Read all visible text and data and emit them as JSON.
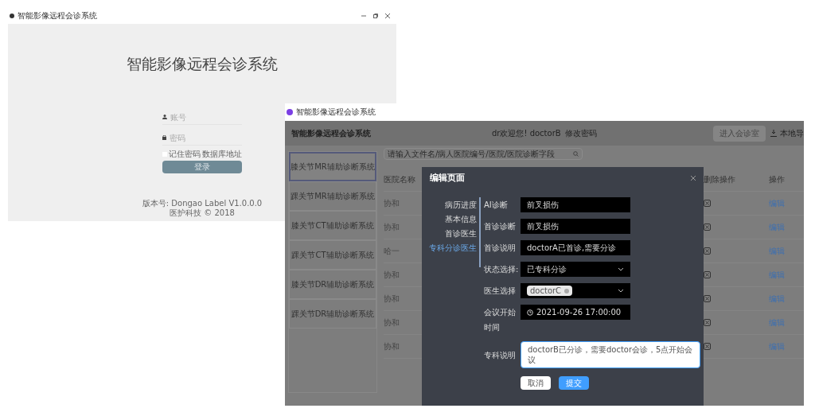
{
  "login_window": {
    "title": "智能影像远程会诊系统",
    "heading": "智能影像远程会诊系统",
    "username_placeholder": "账号",
    "password_placeholder": "密码",
    "remember": {
      "label": "记住密码",
      "checked": false
    },
    "link": "数据库地址",
    "login_button": "登录",
    "footer_lines": [
      "版本号: Dongao Label V1.0.0.0",
      "医护科技 © 2018"
    ]
  },
  "main_window": {
    "title": "智能影像远程会诊系统",
    "app_title": "智能影像远程会诊系统",
    "welcome": "dr欢迎您! doctorB",
    "change_password": "修改密码",
    "enter_button": "进入会诊室",
    "import_button": "本地导",
    "search_placeholder": "请输入文件名/病人医院编号/医院/医院诊断字段",
    "sidebar": [
      {
        "label": "膝关节MR辅助诊断系统",
        "selected": true
      },
      {
        "label": "踝关节MR辅助诊断系统",
        "selected": false
      },
      {
        "label": "膝关节CT辅助诊断系统",
        "selected": false
      },
      {
        "label": "踝关节CT辅助诊断系统",
        "selected": false
      },
      {
        "label": "膝关节DR辅助诊断系统",
        "selected": false
      },
      {
        "label": "踝关节DR辅助诊断系统",
        "selected": false
      }
    ],
    "table": {
      "columns": [
        "医院名称",
        "删除操作",
        "操作"
      ],
      "rows": [
        {
          "hospital": "协和",
          "action": "编辑"
        },
        {
          "hospital": "协和",
          "action": "编辑"
        },
        {
          "hospital": "哈一",
          "action": "编辑"
        },
        {
          "hospital": "协和",
          "action": "编辑"
        },
        {
          "hospital": "协和",
          "action": "编辑"
        },
        {
          "hospital": "协和",
          "action": "编辑"
        },
        {
          "hospital": "协和",
          "action": "编辑"
        }
      ]
    },
    "modal": {
      "title": "编辑页面",
      "steps": [
        {
          "label": "病历进度",
          "selected": false
        },
        {
          "label": "基本信息",
          "selected": false
        },
        {
          "label": "首诊医生",
          "selected": false
        },
        {
          "label": "专科分诊医生",
          "selected": true
        }
      ],
      "fields": [
        {
          "kind": "text",
          "label": "AI诊断",
          "value": "前叉损伤"
        },
        {
          "kind": "text",
          "label": "首诊诊断",
          "value": "前叉损伤"
        },
        {
          "kind": "text",
          "label": "首诊说明",
          "value": "doctorA已首诊,需要分诊"
        },
        {
          "kind": "select",
          "label": "状态选择:",
          "value": "已专科分诊"
        },
        {
          "kind": "tags",
          "label": "医生选择",
          "value": "doctorC"
        },
        {
          "kind": "datetime",
          "label": "会议开始时间",
          "value": "2021-09-26 17:00:00"
        },
        {
          "kind": "textarea",
          "label": "专科说明",
          "value": "doctorB已分诊，需要doctor会诊，5点开始会议"
        }
      ],
      "buttons": [
        {
          "kind": "secondary",
          "label": "取消"
        },
        {
          "kind": "primary",
          "label": "提交"
        }
      ]
    }
  }
}
